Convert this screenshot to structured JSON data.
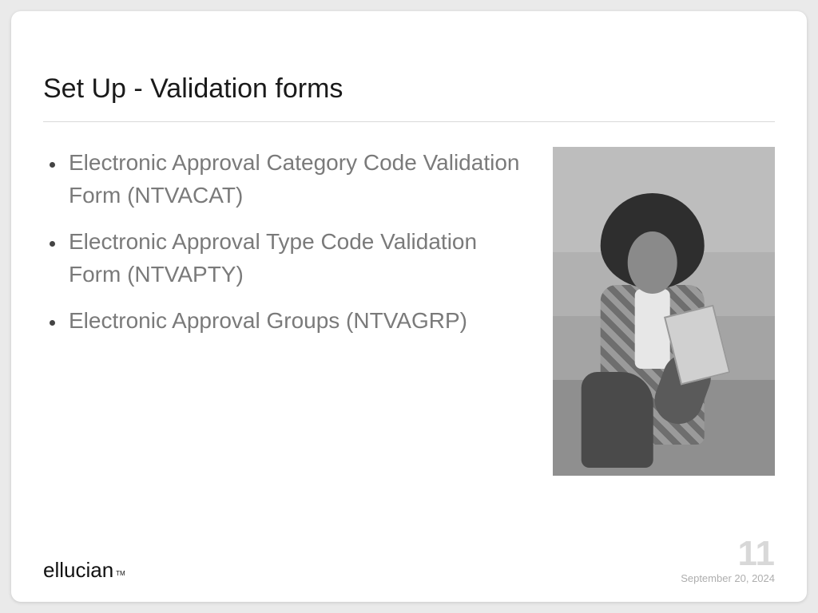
{
  "title": "Set Up - Validation forms",
  "bullets": [
    "Electronic Approval Category Code Validation Form (NTVACAT)",
    "Electronic Approval Type Code Validation Form (NTVAPTY)",
    "Electronic Approval Groups (NTVAGRP)"
  ],
  "footer": {
    "logo": "ellucian",
    "tm": "TM",
    "page_number": "11",
    "date": "September 20, 2024"
  },
  "image": {
    "alt": "Grayscale photo of a young woman with curly hair in a plaid shirt looking at a phone while holding a book, standing on stairs"
  }
}
